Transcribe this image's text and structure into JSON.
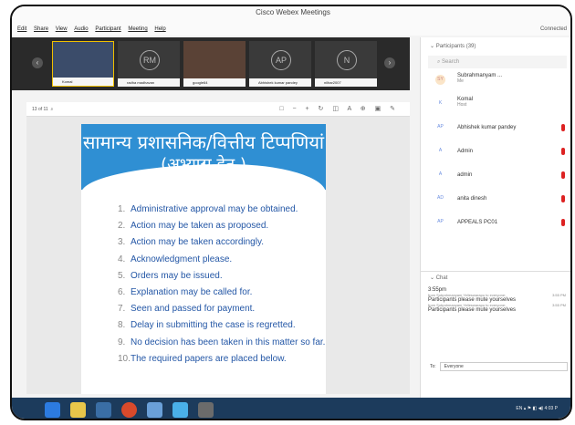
{
  "window": {
    "title": "Cisco Webex Meetings",
    "status": "Connected"
  },
  "menu": [
    "Edit",
    "Share",
    "View",
    "Audio",
    "Participant",
    "Meeting",
    "Help"
  ],
  "thumbnails": [
    {
      "caption": "Komal",
      "avatar": ""
    },
    {
      "caption": "radha madhavan",
      "avatar": "RM"
    },
    {
      "caption": "google64",
      "avatar": ""
    },
    {
      "caption": "Abhishek kumar pandey",
      "avatar": "AP"
    },
    {
      "caption": "nilhar2007",
      "avatar": "N"
    }
  ],
  "toolbar": {
    "page": "13",
    "of": "of 11"
  },
  "slide": {
    "heading1": "सामान्य प्रशासनिक/वित्तीय टिप्पणियां :",
    "heading2": "(अभ्यास हेतु )",
    "items": [
      "Administrative approval may be obtained.",
      "Action may be taken as proposed.",
      "Action may be taken accordingly.",
      "Acknowledgment please.",
      "Orders may be issued.",
      "Explanation may be called for.",
      "Seen and passed for payment.",
      "Delay in submitting the case is regretted.",
      "No decision has been taken in this matter so far.",
      "The required papers are placed below."
    ],
    "numbers": [
      "1.",
      "2.",
      "3.",
      "4.",
      "5.",
      "6.",
      "7.",
      "8.",
      "9.",
      "10."
    ]
  },
  "participants": {
    "header": "Participants (39)",
    "search_placeholder": "Search",
    "list": [
      {
        "initials": "SY",
        "name": "Subrahmanyam ...",
        "role": "Me"
      },
      {
        "initials": "K",
        "name": "Komal",
        "role": "Host"
      },
      {
        "initials": "AP",
        "name": "Abhishek kumar pandey",
        "role": ""
      },
      {
        "initials": "A",
        "name": "Admin",
        "role": ""
      },
      {
        "initials": "A",
        "name": "admin",
        "role": ""
      },
      {
        "initials": "AD",
        "name": "anita dinesh",
        "role": ""
      },
      {
        "initials": "AP",
        "name": "APPEALS PC01",
        "role": ""
      }
    ]
  },
  "chat": {
    "header": "Chat",
    "time": "3:55pm",
    "messages": [
      {
        "from": "from Subrahmanyam Yelleswarapu to everyone:",
        "text": "Participants please mute yourselves",
        "time": "3:55 PM"
      },
      {
        "from": "from Subrahmanyam Yelleswarapu to everyone:",
        "text": "Participants please mute yourselves",
        "time": "3:55 PM"
      }
    ],
    "to_label": "To:",
    "to_value": "Everyone"
  },
  "tray": {
    "lang": "EN",
    "clock": "4:03 P"
  }
}
